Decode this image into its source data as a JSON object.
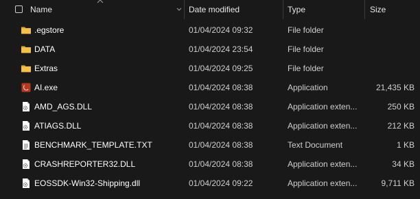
{
  "columns": {
    "name": "Name",
    "date_modified": "Date modified",
    "type": "Type",
    "size": "Size"
  },
  "sort": {
    "column": "name",
    "direction": "ascending",
    "icon": "chevron-up-icon"
  },
  "colors": {
    "background": "#191919",
    "folder": "#f3c04b",
    "folder_dark": "#d9a22a",
    "exe": "#b3391f"
  },
  "files": [
    {
      "name": ".egstore",
      "date": "01/04/2024 09:32",
      "type": "File folder",
      "size": "",
      "icon": "folder-icon"
    },
    {
      "name": "DATA",
      "date": "01/04/2024 23:54",
      "type": "File folder",
      "size": "",
      "icon": "folder-icon"
    },
    {
      "name": "Extras",
      "date": "01/04/2024 09:25",
      "type": "File folder",
      "size": "",
      "icon": "folder-icon"
    },
    {
      "name": "AI.exe",
      "date": "01/04/2024 08:38",
      "type": "Application",
      "size": "21,435 KB",
      "icon": "app-exe-icon"
    },
    {
      "name": "AMD_AGS.DLL",
      "date": "01/04/2024 08:38",
      "type": "Application exten...",
      "size": "250 KB",
      "icon": "dll-file-icon"
    },
    {
      "name": "ATIAGS.DLL",
      "date": "01/04/2024 08:38",
      "type": "Application exten...",
      "size": "212 KB",
      "icon": "dll-file-icon"
    },
    {
      "name": "BENCHMARK_TEMPLATE.TXT",
      "date": "01/04/2024 08:38",
      "type": "Text Document",
      "size": "1 KB",
      "icon": "text-file-icon"
    },
    {
      "name": "CRASHREPORTER32.DLL",
      "date": "01/04/2024 08:38",
      "type": "Application exten...",
      "size": "34 KB",
      "icon": "dll-file-icon"
    },
    {
      "name": "EOSSDK-Win32-Shipping.dll",
      "date": "01/04/2024 09:22",
      "type": "Application exten...",
      "size": "9,711 KB",
      "icon": "dll-file-icon"
    }
  ]
}
